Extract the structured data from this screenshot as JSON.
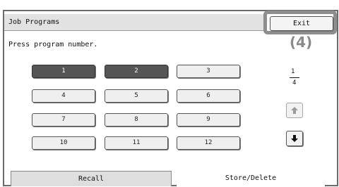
{
  "window": {
    "title": "Job Programs"
  },
  "instruction": "Press program number.",
  "exit": {
    "label": "Exit",
    "callout": "(4)"
  },
  "programs": [
    "1",
    "2",
    "3",
    "4",
    "5",
    "6",
    "7",
    "8",
    "9",
    "10",
    "11",
    "12"
  ],
  "pager": {
    "current": "1",
    "total": "4"
  },
  "tabs": {
    "recall": "Recall",
    "store_delete": "Store/Delete"
  },
  "icons": {
    "up": "arrow-up-icon",
    "down": "arrow-down-icon"
  }
}
